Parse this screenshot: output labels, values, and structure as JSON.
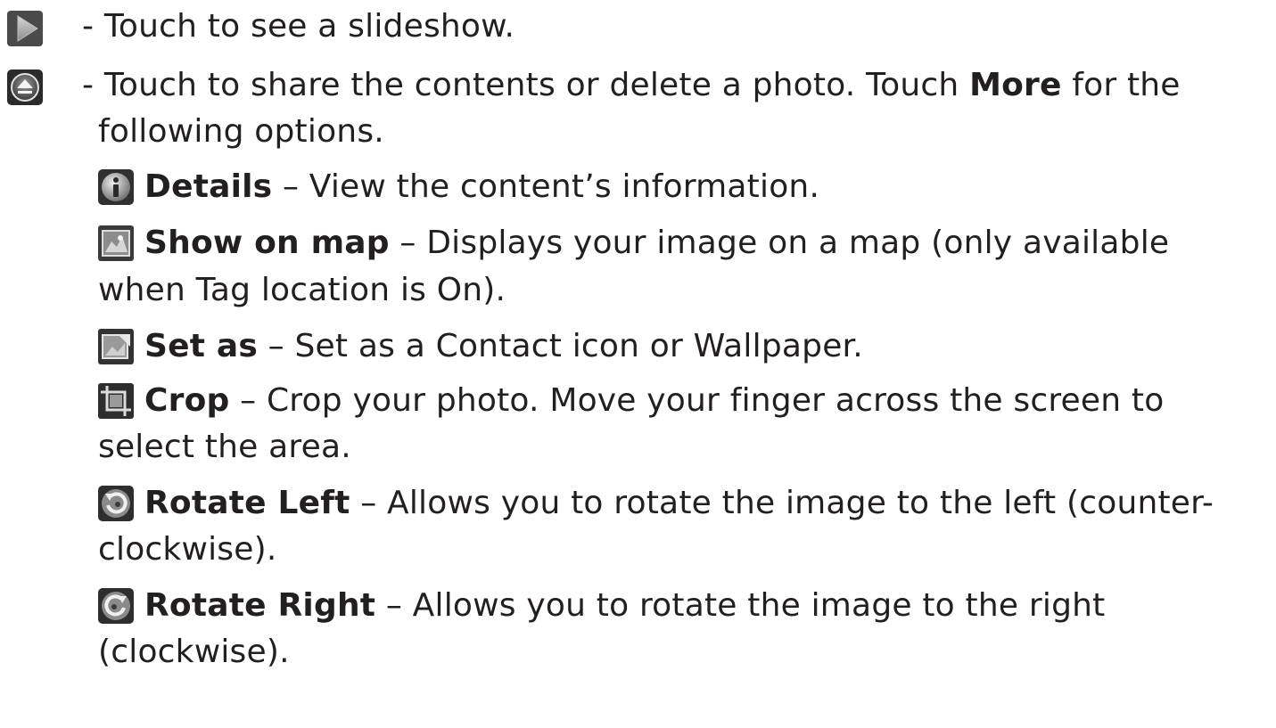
{
  "items": [
    {
      "icon": "play-slideshow-icon",
      "text": "- Touch to see a slideshow."
    },
    {
      "icon": "share-menu-icon",
      "text_line1_a": "- Touch to share the contents or delete a photo. Touch ",
      "text_line1_bold": "More",
      "text_line1_b": " for the",
      "text_line2": "following options."
    }
  ],
  "options": [
    {
      "icon": "info-icon",
      "label": "Details",
      "line1": " – View the content’s information."
    },
    {
      "icon": "map-icon",
      "label": "Show on map",
      "line1": " – Displays your image on a map (only available",
      "line2": "when Tag location is On)."
    },
    {
      "icon": "set-as-icon",
      "label": "Set as",
      "line1": " – Set as a Contact icon or Wallpaper."
    },
    {
      "icon": "crop-icon",
      "label": "Crop",
      "line1": " – Crop your photo. Move your finger across the screen to",
      "line2": "select the area."
    },
    {
      "icon": "rotate-left-icon",
      "label": "Rotate Left",
      "line1": " – Allows you to rotate the image to the left (counter-",
      "line2": "clockwise)."
    },
    {
      "icon": "rotate-right-icon",
      "label": "Rotate Right",
      "line1": " – Allows you to rotate the image to the right",
      "line2": "(clockwise)."
    }
  ]
}
